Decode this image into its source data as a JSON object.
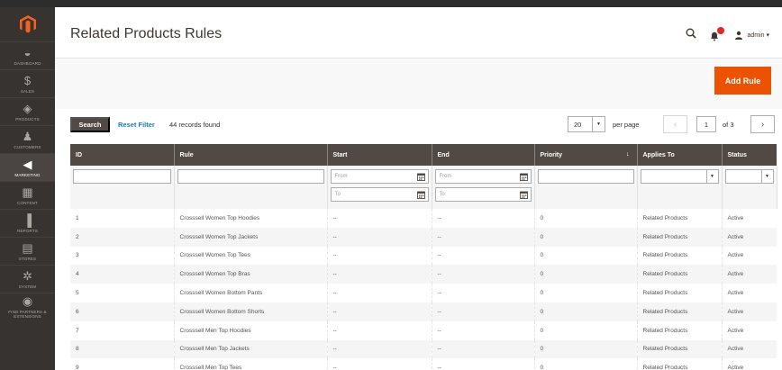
{
  "sidebar": {
    "items": [
      {
        "label": "DASHBOARD",
        "icon": "dashboard-icon",
        "glyph": "◒"
      },
      {
        "label": "SALES",
        "icon": "dollar-icon",
        "glyph": "$"
      },
      {
        "label": "PRODUCTS",
        "icon": "cube-icon",
        "glyph": "◈"
      },
      {
        "label": "CUSTOMERS",
        "icon": "person-icon",
        "glyph": "♟"
      },
      {
        "label": "MARKETING",
        "icon": "megaphone-icon",
        "glyph": "◀"
      },
      {
        "label": "CONTENT",
        "icon": "content-icon",
        "glyph": "▦"
      },
      {
        "label": "REPORTS",
        "icon": "bar-chart-icon",
        "glyph": "▐"
      },
      {
        "label": "STORES",
        "icon": "store-icon",
        "glyph": "▤"
      },
      {
        "label": "SYSTEM",
        "icon": "gear-icon",
        "glyph": "✲"
      },
      {
        "label": "FIND PARTNERS & EXTENSIONS",
        "icon": "partners-icon",
        "glyph": "◉"
      }
    ]
  },
  "header": {
    "title": "Related Products Rules",
    "user": "admin ▾"
  },
  "actions": {
    "add_rule": "Add Rule"
  },
  "grid": {
    "search_label": "Search",
    "reset_label": "Reset Filter",
    "records": "44 records found",
    "per_page_value": "20",
    "per_page_label": "per page",
    "page": "1",
    "of_pages": "of 3"
  },
  "table": {
    "columns": [
      "ID",
      "Rule",
      "Start",
      "End",
      "Priority",
      "Applies To",
      "Status"
    ],
    "from_placeholder": "From",
    "to_placeholder": "To",
    "rows": [
      {
        "id": "1",
        "rule": "Crosssell Women Top Hoodies",
        "start": "--",
        "end": "--",
        "priority": "0",
        "applies": "Related Products",
        "status": "Active"
      },
      {
        "id": "2",
        "rule": "Crosssell Women Top Jackets",
        "start": "--",
        "end": "--",
        "priority": "0",
        "applies": "Related Products",
        "status": "Active"
      },
      {
        "id": "3",
        "rule": "Crosssell Women Top Tees",
        "start": "--",
        "end": "--",
        "priority": "0",
        "applies": "Related Products",
        "status": "Active"
      },
      {
        "id": "4",
        "rule": "Crosssell Women Top Bras",
        "start": "--",
        "end": "--",
        "priority": "0",
        "applies": "Related Products",
        "status": "Active"
      },
      {
        "id": "5",
        "rule": "Crosssell Women Bottom Pants",
        "start": "--",
        "end": "--",
        "priority": "0",
        "applies": "Related Products",
        "status": "Active"
      },
      {
        "id": "6",
        "rule": "Crosssell Women Bottom Shorts",
        "start": "--",
        "end": "--",
        "priority": "0",
        "applies": "Related Products",
        "status": "Active"
      },
      {
        "id": "7",
        "rule": "Crosssell Men Top Hoodies",
        "start": "--",
        "end": "--",
        "priority": "0",
        "applies": "Related Products",
        "status": "Active"
      },
      {
        "id": "8",
        "rule": "Crosssell Men Top Jackets",
        "start": "--",
        "end": "--",
        "priority": "0",
        "applies": "Related Products",
        "status": "Active"
      },
      {
        "id": "9",
        "rule": "Crosssell Men Top Tees",
        "start": "--",
        "end": "--",
        "priority": "0",
        "applies": "Related Products",
        "status": "Active"
      }
    ]
  },
  "colors": {
    "sidebar": "#373330",
    "accent": "#eb5202",
    "table_header": "#514943",
    "link": "#1979c3"
  }
}
